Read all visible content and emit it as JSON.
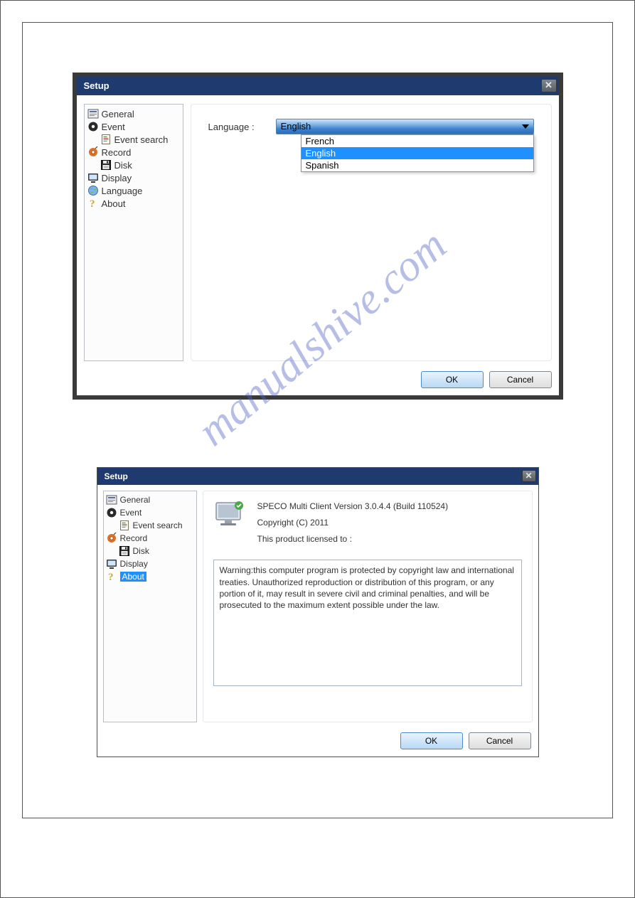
{
  "dialog1": {
    "title": "Setup",
    "close_glyph": "✕",
    "tree": {
      "general": "General",
      "event": "Event",
      "event_search": "Event search",
      "record": "Record",
      "disk": "Disk",
      "display": "Display",
      "language": "Language",
      "about": "About"
    },
    "content": {
      "language_label": "Language :",
      "selected": "English",
      "options": {
        "opt0": "French",
        "opt1": "English",
        "opt2": "Spanish"
      }
    },
    "footer": {
      "ok": "OK",
      "cancel": "Cancel"
    }
  },
  "dialog2": {
    "title": "Setup",
    "close_glyph": "✕",
    "tree": {
      "general": "General",
      "event": "Event",
      "event_search": "Event search",
      "record": "Record",
      "disk": "Disk",
      "display": "Display",
      "about": "About"
    },
    "content": {
      "version_line": "SPECO Multi Client Version 3.0.4.4 (Build 110524)",
      "copyright_line": "Copyright (C) 2011",
      "licensed_line": "This product licensed to :",
      "warning": "Warning:this computer program is protected by copyright law and international treaties. Unauthorized reproduction or distribution of this program, or any portion of it, may result in severe civil and criminal penalties, and will be prosecuted to the maximum extent possible under the law."
    },
    "footer": {
      "ok": "OK",
      "cancel": "Cancel"
    }
  },
  "watermark": "manualshive.com",
  "icons": {
    "general": "general-icon",
    "event": "event-icon",
    "event_search": "document-search-icon",
    "record": "record-icon",
    "disk": "floppy-disk-icon",
    "display": "display-icon",
    "language": "globe-icon",
    "about": "question-icon",
    "monitor": "monitor-icon",
    "close": "close-icon",
    "dropdown_caret": "chevron-down-icon"
  },
  "colors": {
    "title_bar": "#1f3a6e",
    "selection": "#1e90ff",
    "ok_border": "#4b8acc"
  }
}
